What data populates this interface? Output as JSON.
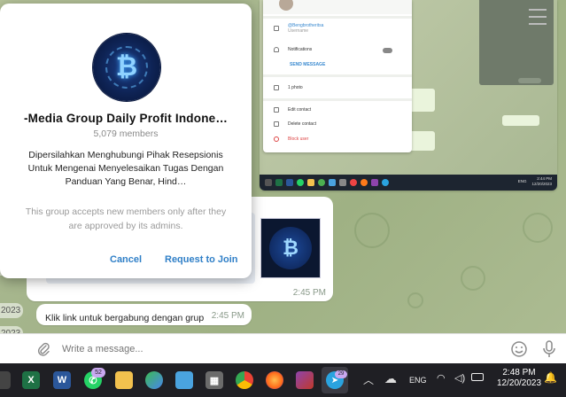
{
  "dialog": {
    "group_title": "-Media Group Daily Profit Indone…",
    "member_count": "5,079 members",
    "description": "Dipersilahkan Menghubungi Pihak Resepsionis Untuk Mengenai Menyelesaikan Tugas Dengan Panduan Yang Benar, Hind…",
    "admin_note": "This group accepts new members only after they are approved by its admins.",
    "cancel_label": "Cancel",
    "join_label": "Request to Join",
    "avatar_icon": "bitcoin-icon",
    "avatar_glyph": "₿"
  },
  "chat": {
    "thumb_glyph": "₿",
    "message1_time": "2:45 PM",
    "message2_text": "Klik link untuk bergabung dengan grup",
    "message2_time": "2:45 PM",
    "date_stub_1": "023",
    "date_stub_2": "2023",
    "date_stub_3": "2023",
    "input_placeholder": "Write a message..."
  },
  "inner_screenshot": {
    "username": "@Bengbrotheritsa",
    "username_label": "Username",
    "notifications": "Notifications",
    "send_message": "SEND MESSAGE",
    "photos": "1 photo",
    "edit_contact": "Edit contact",
    "delete_contact": "Delete contact",
    "block_user": "Block user",
    "lang": "ENG",
    "time": "2:44 PM",
    "date": "12/20/2023"
  },
  "taskbar": {
    "whatsapp_badge": "52",
    "telegram_badge": "29",
    "lang": "ENG",
    "time": "2:48 PM",
    "date": "12/20/2023"
  },
  "colors": {
    "accent": "#2f7fc7",
    "taskbar": "#1f1f24",
    "chat_bg": "#a5b58c"
  }
}
